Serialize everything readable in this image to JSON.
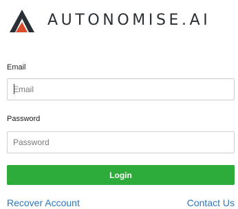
{
  "brand": {
    "logo_icon": "autonomise-logo-icon",
    "name": "AUTONOMISE.AI"
  },
  "login_form": {
    "email_label": "Email",
    "email_placeholder": "Email",
    "password_label": "Password",
    "password_placeholder": "Password",
    "login_label": "Login"
  },
  "footer_links": {
    "recover_account": "Recover Account",
    "contact_us": "Contact Us"
  },
  "colors": {
    "login_button": "#2dab3b",
    "link": "#2a78c2",
    "brand_text": "#2a2f36"
  }
}
